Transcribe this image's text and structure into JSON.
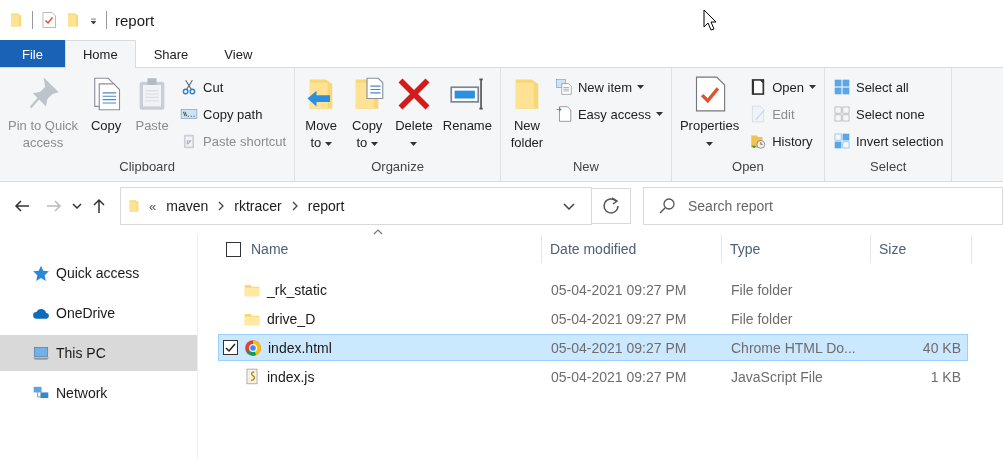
{
  "title_bar": {
    "title": "report"
  },
  "tabs": [
    {
      "label": "File",
      "kind": "file",
      "selected": false
    },
    {
      "label": "Home",
      "kind": "tab",
      "selected": true
    },
    {
      "label": "Share",
      "kind": "tab",
      "selected": false
    },
    {
      "label": "View",
      "kind": "tab",
      "selected": false
    }
  ],
  "ribbon": {
    "groups": [
      {
        "label": "Clipboard",
        "items": [
          {
            "kind": "large",
            "label": "Pin to Quick\naccess",
            "disabled": true
          },
          {
            "kind": "large",
            "label": "Copy",
            "disabled": false
          },
          {
            "kind": "large",
            "label": "Paste",
            "disabled": true
          },
          {
            "kind": "small",
            "label": "Cut",
            "disabled": false
          },
          {
            "kind": "small",
            "label": "Copy path",
            "disabled": false
          },
          {
            "kind": "small",
            "label": "Paste shortcut",
            "disabled": true
          }
        ]
      },
      {
        "label": "Organize",
        "items": [
          {
            "kind": "large",
            "label": "Move\nto",
            "dropdown": true,
            "disabled": false
          },
          {
            "kind": "large",
            "label": "Copy\nto",
            "dropdown": true,
            "disabled": false
          },
          {
            "kind": "large",
            "label": "Delete",
            "dropdown": true,
            "dropdown_below": true,
            "disabled": false
          },
          {
            "kind": "large",
            "label": "Rename",
            "disabled": false
          }
        ]
      },
      {
        "label": "New",
        "items": [
          {
            "kind": "large",
            "label": "New\nfolder",
            "disabled": false
          },
          {
            "kind": "small",
            "label": "New item",
            "dropdown": true,
            "disabled": false
          },
          {
            "kind": "small",
            "label": "Easy access",
            "dropdown": true,
            "disabled": false
          }
        ]
      },
      {
        "label": "Open",
        "items": [
          {
            "kind": "large",
            "label": "Properties",
            "dropdown": true,
            "dropdown_below": true,
            "disabled": false
          },
          {
            "kind": "small",
            "label": "Open",
            "dropdown": true,
            "disabled": false
          },
          {
            "kind": "small",
            "label": "Edit",
            "disabled": true
          },
          {
            "kind": "small",
            "label": "History",
            "disabled": false
          }
        ]
      },
      {
        "label": "Select",
        "items": [
          {
            "kind": "small",
            "label": "Select all",
            "disabled": false
          },
          {
            "kind": "small",
            "label": "Select none",
            "disabled": false
          },
          {
            "kind": "small",
            "label": "Invert selection",
            "disabled": false
          }
        ]
      }
    ]
  },
  "address_bar": {
    "overflow": "«",
    "crumbs": [
      "maven",
      "rktracer",
      "report"
    ],
    "forward_disabled": true
  },
  "search": {
    "placeholder": "Search report"
  },
  "navigation": {
    "items": [
      {
        "label": "Quick access",
        "selected": false
      },
      {
        "label": "OneDrive",
        "selected": false
      },
      {
        "label": "This PC",
        "selected": true
      },
      {
        "label": "Network",
        "selected": false
      }
    ]
  },
  "file_list": {
    "columns": [
      "Name",
      "Date modified",
      "Type",
      "Size"
    ],
    "select_all_checked": false,
    "rows": [
      {
        "kind": "folder",
        "name": "_rk_static",
        "date_modified": "05-04-2021 09:27 PM",
        "type": "File folder",
        "selected": false,
        "checked": false
      },
      {
        "kind": "folder",
        "name": "drive_D",
        "date_modified": "05-04-2021 09:27 PM",
        "type": "File folder",
        "selected": false,
        "checked": false
      },
      {
        "kind": "html",
        "name": "index.html",
        "date_modified": "05-04-2021 09:27 PM",
        "type": "Chrome HTML Do...",
        "size": "40 KB",
        "selected": true,
        "checked": true
      },
      {
        "kind": "script",
        "name": "index.js",
        "date_modified": "05-04-2021 09:27 PM",
        "type": "JavaScript File",
        "size": "1 KB",
        "selected": false,
        "checked": false
      }
    ]
  }
}
